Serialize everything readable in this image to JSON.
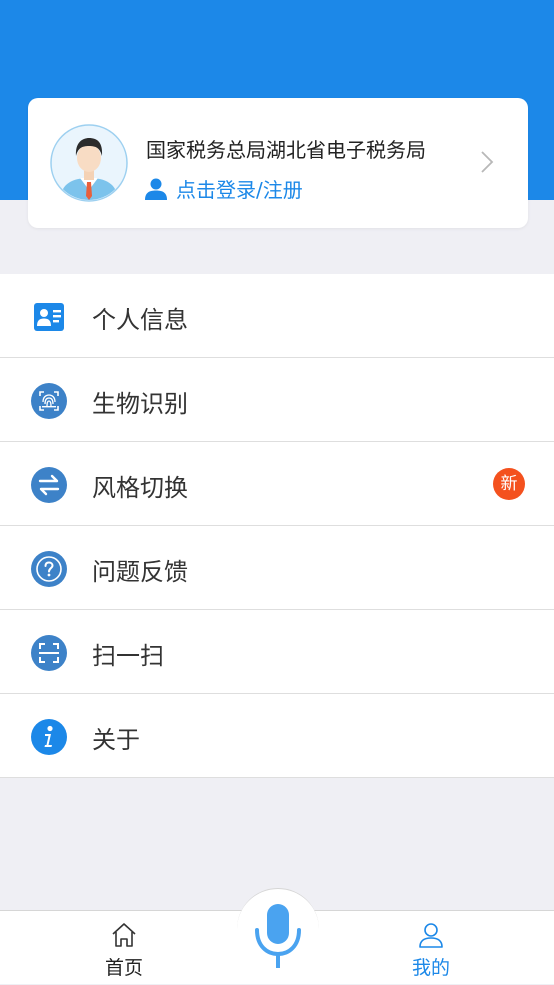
{
  "profile": {
    "org_name": "国家税务总局湖北省电子税务局",
    "login_text": "点击登录/注册"
  },
  "menu": [
    {
      "label": "个人信息",
      "icon": "id-card-icon"
    },
    {
      "label": "生物识别",
      "icon": "fingerprint-icon"
    },
    {
      "label": "风格切换",
      "icon": "swap-icon",
      "badge": "新"
    },
    {
      "label": "问题反馈",
      "icon": "question-icon"
    },
    {
      "label": "扫一扫",
      "icon": "scan-icon"
    },
    {
      "label": "关于",
      "icon": "info-icon"
    }
  ],
  "tabbar": {
    "home_label": "首页",
    "mine_label": "我的",
    "active": "mine"
  },
  "colors": {
    "brand": "#1c88e8",
    "badge": "#f4511e",
    "background": "#efeff4"
  }
}
